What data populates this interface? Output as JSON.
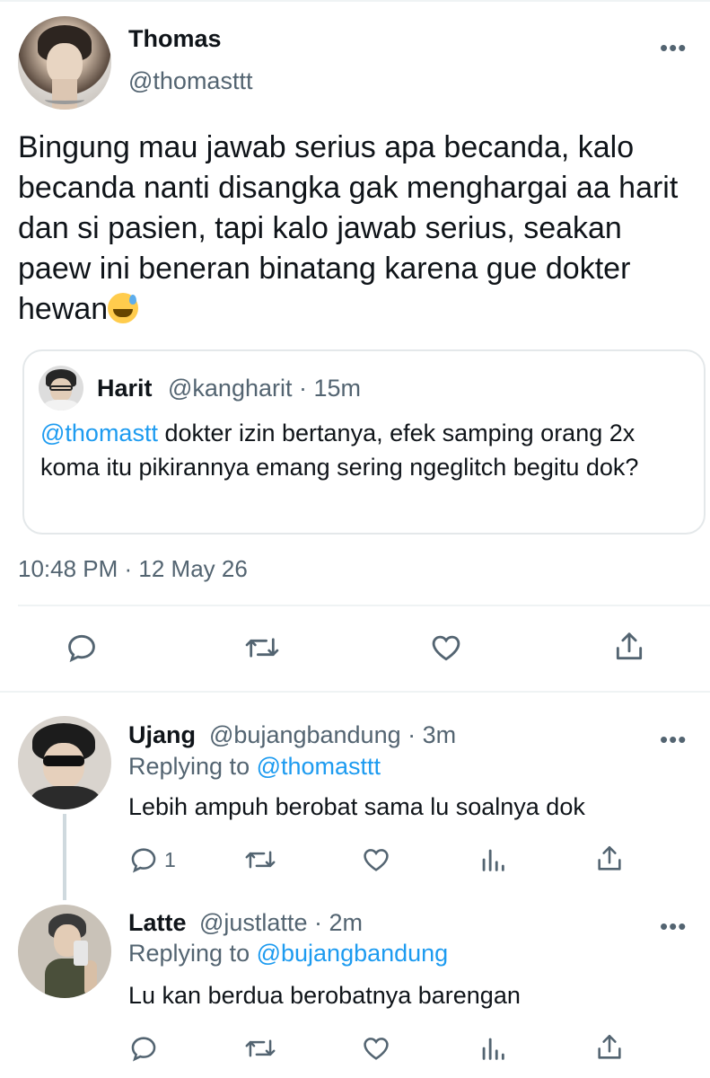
{
  "main_tweet": {
    "name": "Thomas",
    "handle": "@thomasttt",
    "text": "Bingung mau jawab serius apa becanda, kalo becanda nanti disangka gak menghargai aa harit dan si pasien, tapi kalo jawab serius, seakan paew ini beneran binatang karena gue dokter hewan",
    "emoji": "grinning-face-with-sweat",
    "timestamp": "10:48 PM · 12 May 26",
    "more": "•••",
    "quote": {
      "name": "Harit",
      "meta": "@kangharit · 15m",
      "mention": "@thomastt",
      "text": " dokter izin bertanya, efek samping orang 2x koma itu pikirannya emang sering ngeglitch begitu dok?"
    },
    "actions": [
      "reply-icon",
      "retweet-icon",
      "like-icon",
      "share-icon"
    ]
  },
  "replies": [
    {
      "name": "Ujang",
      "meta": "@bujangbandung · 3m",
      "replying_prefix": "Replying to ",
      "replying_to": "@thomasttt",
      "text": "Lebih ampuh berobat sama lu soalnya dok",
      "reply_count": "1",
      "more": "•••"
    },
    {
      "name": "Latte",
      "meta": "@justlatte · 2m",
      "replying_prefix": "Replying to ",
      "replying_to": "@bujangbandung",
      "text": "Lu kan berdua berobatnya barengan",
      "reply_count": "",
      "more": "•••"
    }
  ],
  "colors": {
    "text": "#0f1419",
    "secondary": "#536471",
    "accent": "#1d9bf0",
    "border": "#eff3f4"
  }
}
